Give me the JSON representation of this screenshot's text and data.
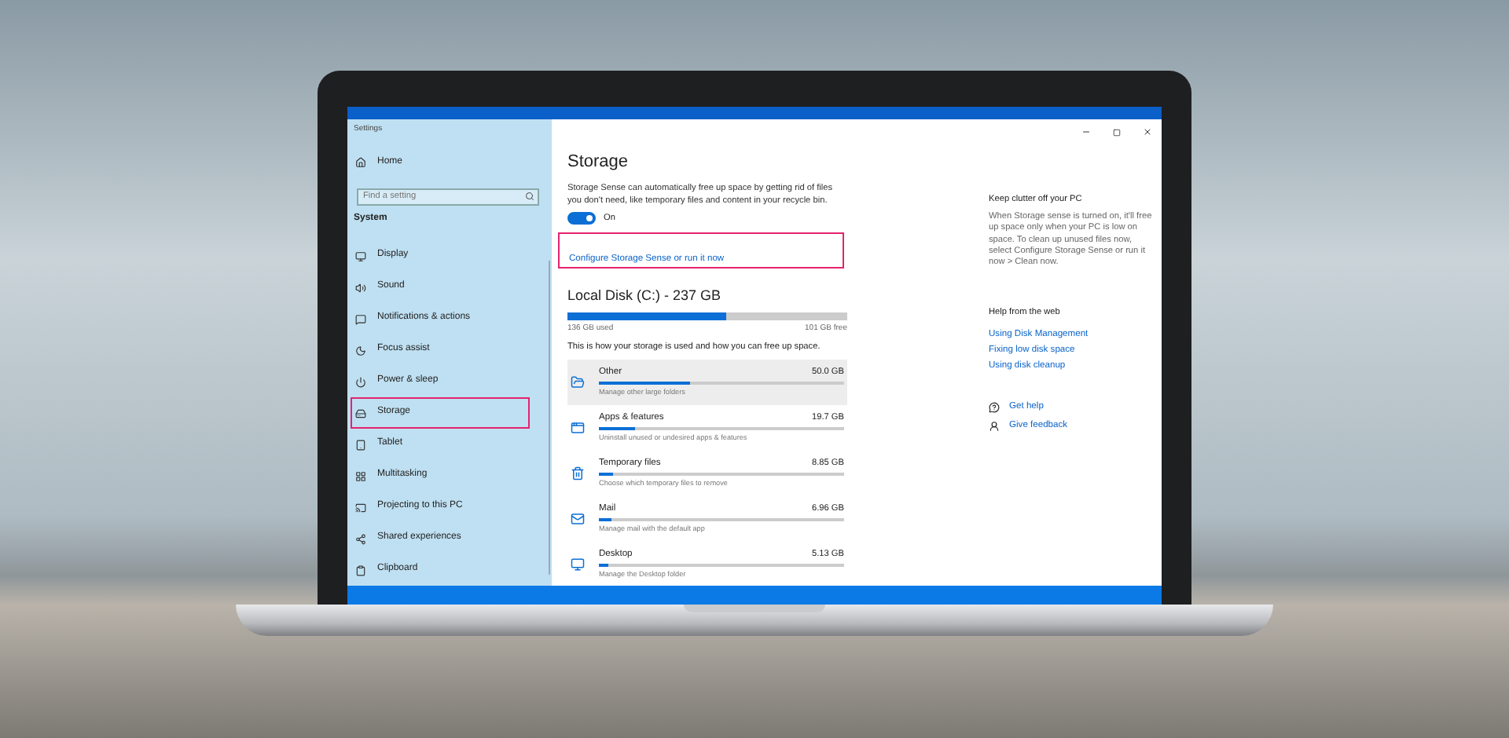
{
  "window": {
    "title": "Settings"
  },
  "sidebar": {
    "home": "Home",
    "search": {
      "placeholder": "Find a setting"
    },
    "section": "System",
    "items": [
      {
        "label": "Display",
        "highlighted": false
      },
      {
        "label": "Sound",
        "highlighted": false
      },
      {
        "label": "Notifications & actions",
        "highlighted": false
      },
      {
        "label": "Focus assist",
        "highlighted": false
      },
      {
        "label": "Power & sleep",
        "highlighted": false
      },
      {
        "label": "Storage",
        "highlighted": true
      },
      {
        "label": "Tablet",
        "highlighted": false
      },
      {
        "label": "Multitasking",
        "highlighted": false
      },
      {
        "label": "Projecting to this PC",
        "highlighted": false
      },
      {
        "label": "Shared experiences",
        "highlighted": false
      },
      {
        "label": "Clipboard",
        "highlighted": false
      }
    ]
  },
  "storage": {
    "title": "Storage",
    "description": "Storage Sense can automatically free up space by getting rid of files you don't need, like temporary files and content in your recycle bin.",
    "toggle": {
      "on": true,
      "label": "On"
    },
    "link": {
      "text": "Configure Storage Sense or run it now",
      "highlighted": true
    }
  },
  "disk": {
    "title": "Local Disk (C:) - 237 GB",
    "level": 0.57,
    "used": "136 GB used",
    "free": "101 GB free",
    "note": "This is how your storage is used and how you can free up space.",
    "items": [
      {
        "name": "Other",
        "size": "50.0 GB",
        "description": "Manage other large folders",
        "level": 0.37,
        "selected": true
      },
      {
        "name": "Apps & features",
        "size": "19.7 GB",
        "description": "Uninstall unused or undesired apps & features",
        "level": 0.15,
        "selected": false
      },
      {
        "name": "Temporary files",
        "size": "8.85 GB",
        "description": "Choose which temporary files to remove",
        "level": 0.06,
        "selected": false
      },
      {
        "name": "Mail",
        "size": "6.96 GB",
        "description": "Manage mail with the default app",
        "level": 0.05,
        "selected": false
      },
      {
        "name": "Desktop",
        "size": "5.13 GB",
        "description": "Manage the Desktop folder",
        "level": 0.04,
        "selected": false
      }
    ]
  },
  "aside": {
    "title": "Keep clutter off your PC",
    "text": "When Storage sense is turned on, it'll free up space only when your PC is low on space. To clean up unused files now, select Configure Storage Sense or run it now > Clean now.",
    "help_title": "Help from the web",
    "links": [
      "Using Disk Management",
      "Fixing low disk space",
      "Using disk cleanup"
    ],
    "actions": [
      "Get help",
      "Give feedback"
    ]
  }
}
